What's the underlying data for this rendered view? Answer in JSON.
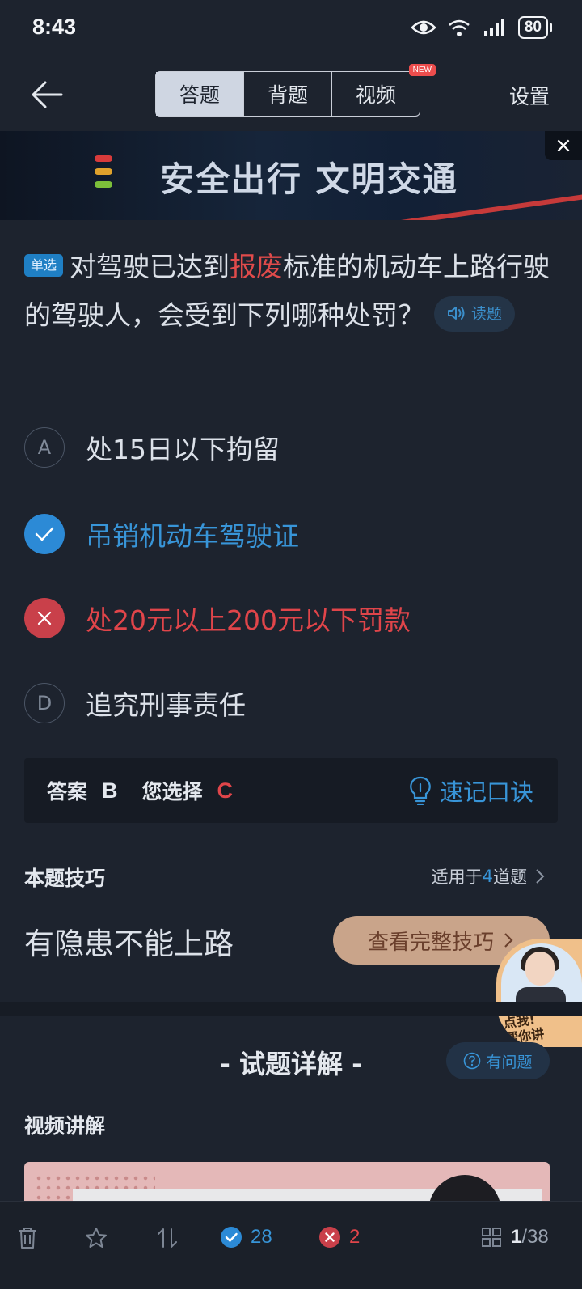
{
  "status_bar": {
    "time": "8:43",
    "battery": "80"
  },
  "header": {
    "tabs": [
      {
        "label": "答题",
        "active": true
      },
      {
        "label": "背题",
        "active": false
      },
      {
        "label": "视频",
        "active": false,
        "badge": "NEW"
      }
    ],
    "settings_label": "设置"
  },
  "banner": {
    "text": "安全出行 文明交通",
    "close": "×"
  },
  "question": {
    "type": "单选",
    "text_before": "对驾驶已达到",
    "highlight": "报废",
    "text_after": "标准的机动车上路行驶的驾驶人，会受到下列哪种处罚？",
    "read_label": "读题"
  },
  "options": [
    {
      "key": "A",
      "text": "处15日以下拘留",
      "state": "plain"
    },
    {
      "key": "B",
      "text": "吊销机动车驾驶证",
      "state": "correct"
    },
    {
      "key": "C",
      "text": "处20元以上200元以下罚款",
      "state": "wrong"
    },
    {
      "key": "D",
      "text": "追究刑事责任",
      "state": "plain"
    }
  ],
  "answer": {
    "label": "答案",
    "value": "B",
    "your_label": "您选择",
    "your_value": "C",
    "mnemonic_label": "速记口诀"
  },
  "tips": {
    "title": "本题技巧",
    "applies_prefix": "适用于",
    "applies_count": "4",
    "applies_suffix": "道题",
    "text": "有隐患不能上路",
    "button": "查看完整技巧"
  },
  "assistant": {
    "tag_line1": "点我!",
    "tag_line2": "帮你讲"
  },
  "detail": {
    "title": "- 试题详解 -",
    "problem_button": "有问题",
    "video_title": "视频讲解"
  },
  "bottom_bar": {
    "correct_count": "28",
    "wrong_count": "2",
    "page_current": "1",
    "page_total": "/38"
  },
  "colors": {
    "accent": "#3895d8",
    "error": "#e0454a",
    "background": "#1d232e"
  }
}
